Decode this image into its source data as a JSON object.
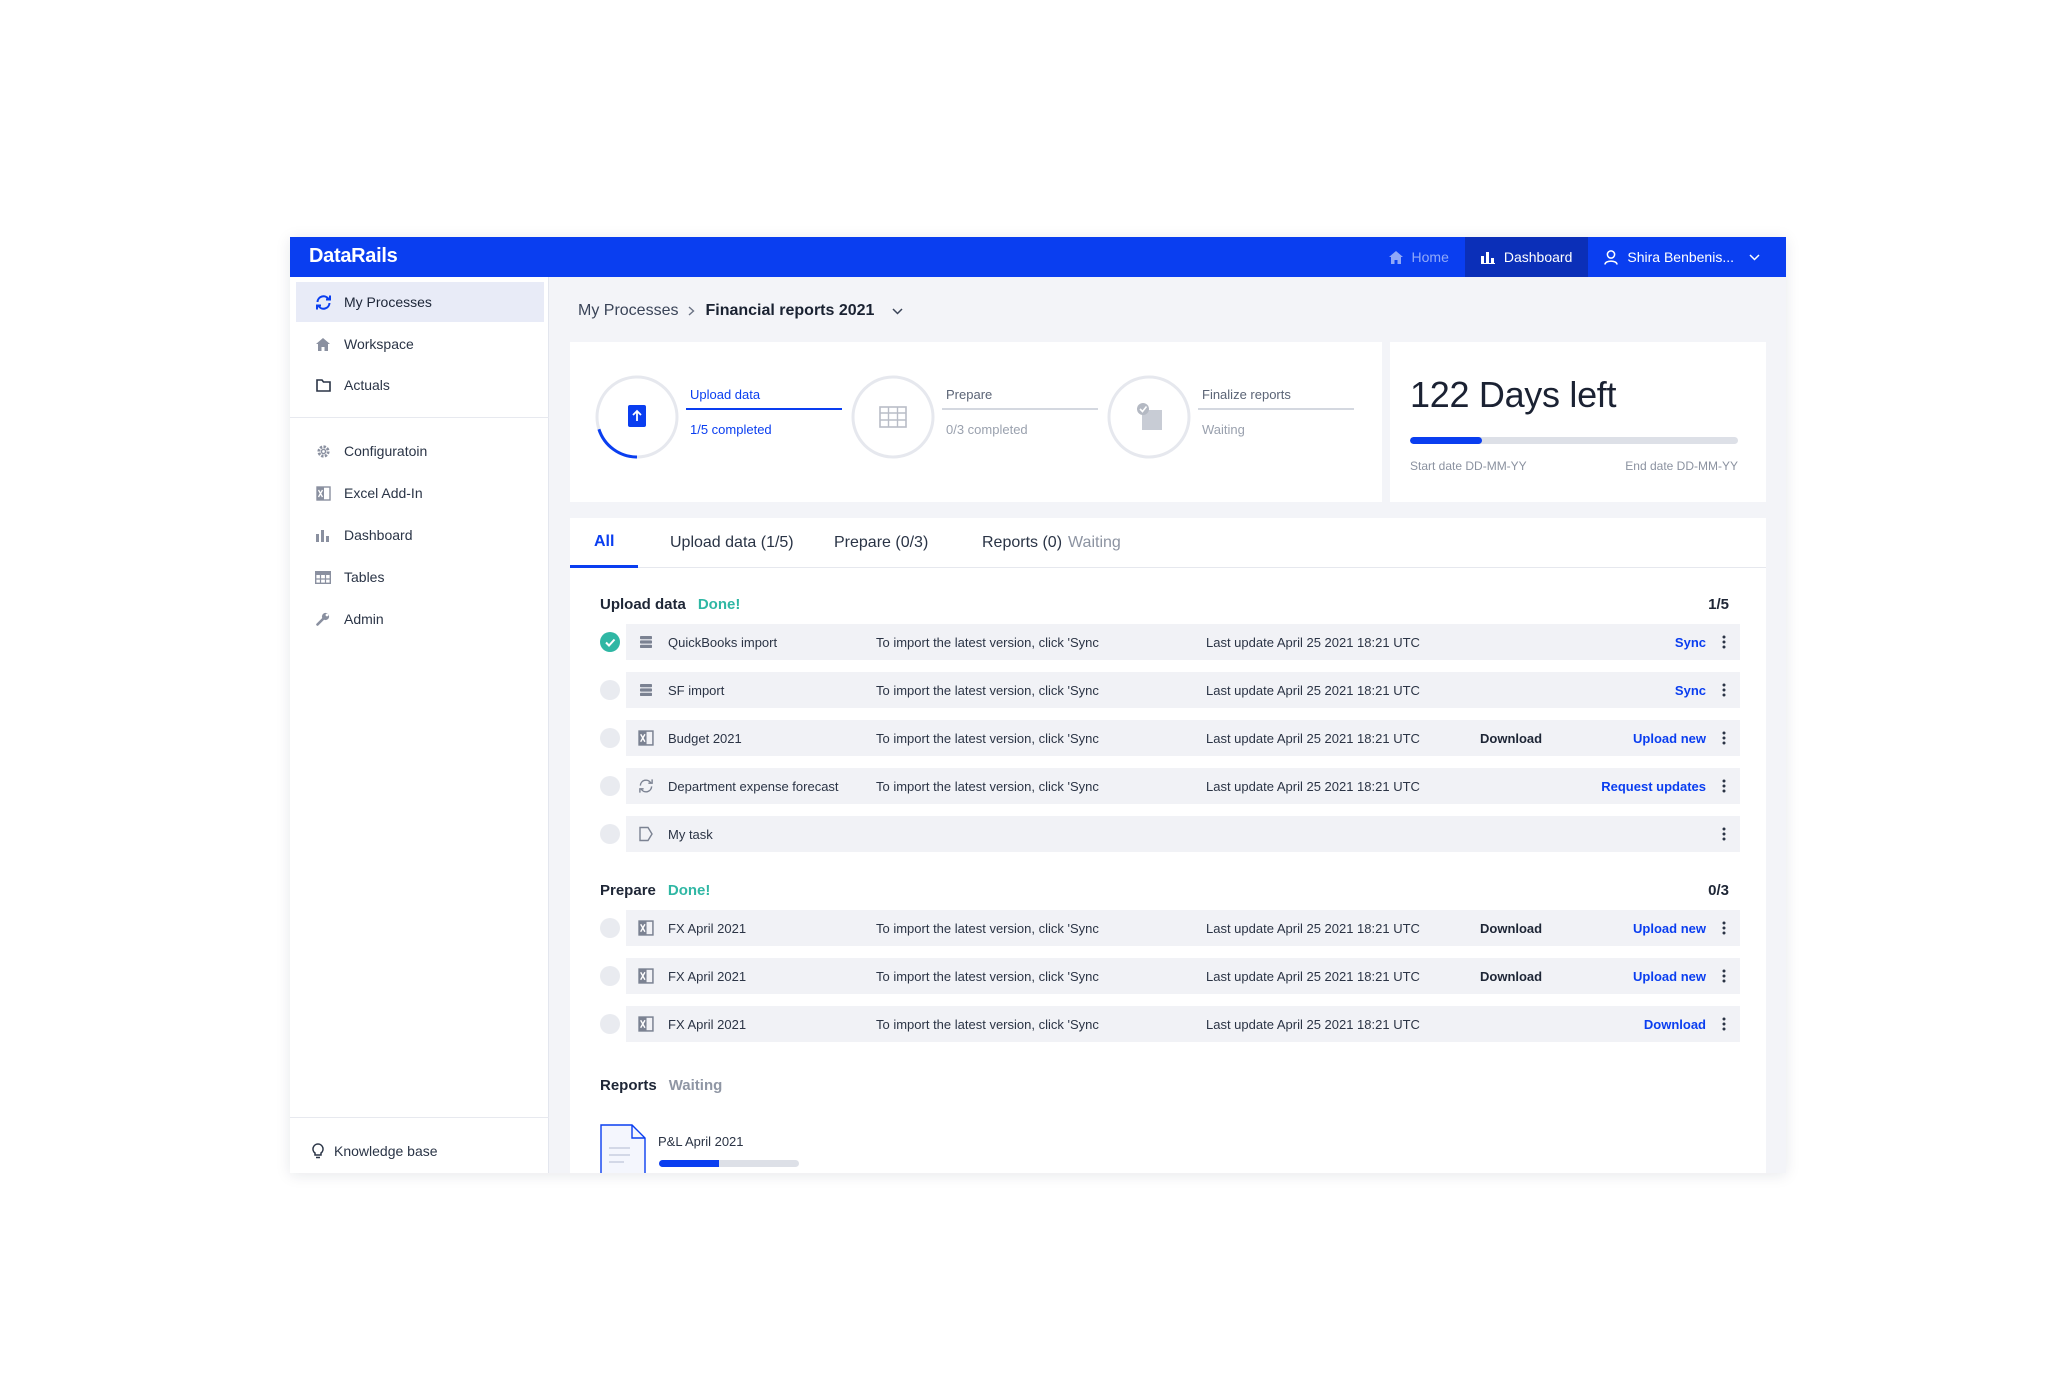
{
  "app": {
    "logo": "DataRails"
  },
  "topbar": {
    "home": "Home",
    "dashboard": "Dashboard",
    "user": "Shira Benbenis..."
  },
  "sidebar": {
    "items": [
      {
        "label": "My Processes",
        "icon": "sync-icon",
        "active": true
      },
      {
        "label": "Workspace",
        "icon": "home-icon"
      },
      {
        "label": "Actuals",
        "icon": "folder-icon"
      },
      {
        "label": "Configuratoin",
        "icon": "gear-icon"
      },
      {
        "label": "Excel Add-In",
        "icon": "excel-icon"
      },
      {
        "label": "Dashboard",
        "icon": "bar-chart-icon"
      },
      {
        "label": "Tables",
        "icon": "table-icon"
      },
      {
        "label": "Admin",
        "icon": "wrench-icon"
      }
    ],
    "knowledge_base": "Knowledge base"
  },
  "breadcrumb": {
    "parent": "My Processes",
    "current": "Financial reports 2021"
  },
  "steps": [
    {
      "title": "Upload data",
      "sub": "1/5 completed",
      "active": true,
      "progress": 0.2
    },
    {
      "title": "Prepare",
      "sub": "0/3 completed",
      "active": false,
      "progress": 0
    },
    {
      "title": "Finalize reports",
      "sub": "Waiting",
      "active": false,
      "progress": 0
    }
  ],
  "days": {
    "title": "122 Days left",
    "progress": 0.22,
    "start": "Start date DD-MM-YY",
    "end": "End date DD-MM-YY"
  },
  "tabs": {
    "all": "All",
    "upload": "Upload data (1/5)",
    "prepare": "Prepare (0/3)",
    "reports": "Reports (0)",
    "reports_status": "Waiting"
  },
  "upload_section": {
    "title": "Upload data",
    "status": "Done!",
    "count": "1/5",
    "rows": [
      {
        "name": "QuickBooks import",
        "desc": "To import the latest version, click 'Sync",
        "update": "Last update April 25 2021 18:21 UTC",
        "download": "",
        "action": "Sync",
        "done": true,
        "icon": "database-icon"
      },
      {
        "name": "SF import",
        "desc": "To import the latest version, click 'Sync",
        "update": "Last update April 25 2021 18:21 UTC",
        "download": "",
        "action": "Sync",
        "done": false,
        "icon": "database-icon"
      },
      {
        "name": "Budget 2021",
        "desc": "To import the latest version, click 'Sync",
        "update": "Last update April 25 2021 18:21 UTC",
        "download": "Download",
        "action": "Upload new",
        "done": false,
        "icon": "excel-icon"
      },
      {
        "name": "Department expense forecast",
        "desc": "To import the latest version, click 'Sync",
        "update": "Last update April 25 2021 18:21 UTC",
        "download": "",
        "action": "Request updates",
        "done": false,
        "icon": "refresh-icon"
      },
      {
        "name": "My task",
        "desc": "",
        "update": "",
        "download": "",
        "action": "",
        "done": false,
        "icon": "task-icon"
      }
    ]
  },
  "prepare_section": {
    "title": "Prepare",
    "status": "Done!",
    "count": "0/3",
    "rows": [
      {
        "name": "FX April 2021",
        "desc": "To import the latest version, click 'Sync",
        "update": "Last update April 25 2021 18:21 UTC",
        "download": "Download",
        "action": "Upload new",
        "done": false,
        "icon": "excel-icon"
      },
      {
        "name": "FX April 2021",
        "desc": "To import the latest version, click 'Sync",
        "update": "Last update April 25 2021 18:21 UTC",
        "download": "Download",
        "action": "Upload new",
        "done": false,
        "icon": "excel-icon"
      },
      {
        "name": "FX April 2021",
        "desc": "To import the latest version, click 'Sync",
        "update": "Last update April 25 2021 18:21 UTC",
        "download": "",
        "action": "Download",
        "done": false,
        "icon": "excel-icon"
      }
    ]
  },
  "reports_section": {
    "title": "Reports",
    "status": "Waiting",
    "report": {
      "name": "P&L April 2021",
      "progress": 0.43
    }
  },
  "colors": {
    "brand": "#0a3ef0",
    "done": "#2fb7a4"
  }
}
